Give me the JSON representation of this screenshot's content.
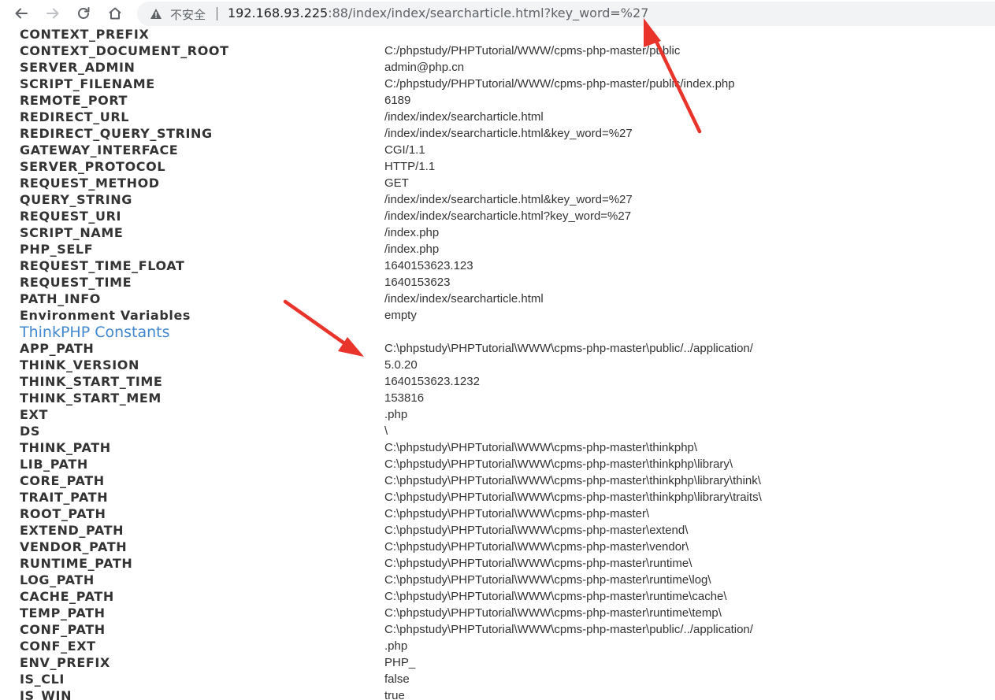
{
  "browser": {
    "insecure_label": "不安全",
    "url_host": "192.168.93.225",
    "url_rest": ":88/index/index/searcharticle.html?key_word=%27"
  },
  "rows_top": [
    {
      "key": "CONTEXT_PREFIX",
      "value": ""
    },
    {
      "key": "CONTEXT_DOCUMENT_ROOT",
      "value": "C:/phpstudy/PHPTutorial/WWW/cpms-php-master/public"
    },
    {
      "key": "SERVER_ADMIN",
      "value": "admin@php.cn"
    },
    {
      "key": "SCRIPT_FILENAME",
      "value": "C:/phpstudy/PHPTutorial/WWW/cpms-php-master/public/index.php"
    },
    {
      "key": "REMOTE_PORT",
      "value": "6189"
    },
    {
      "key": "REDIRECT_URL",
      "value": "/index/index/searcharticle.html"
    },
    {
      "key": "REDIRECT_QUERY_STRING",
      "value": "/index/index/searcharticle.html&key_word=%27"
    },
    {
      "key": "GATEWAY_INTERFACE",
      "value": "CGI/1.1"
    },
    {
      "key": "SERVER_PROTOCOL",
      "value": "HTTP/1.1"
    },
    {
      "key": "REQUEST_METHOD",
      "value": "GET"
    },
    {
      "key": "QUERY_STRING",
      "value": "/index/index/searcharticle.html&key_word=%27"
    },
    {
      "key": "REQUEST_URI",
      "value": "/index/index/searcharticle.html?key_word=%27"
    },
    {
      "key": "SCRIPT_NAME",
      "value": "/index.php"
    },
    {
      "key": "PHP_SELF",
      "value": "/index.php"
    },
    {
      "key": "REQUEST_TIME_FLOAT",
      "value": "1640153623.123"
    },
    {
      "key": "REQUEST_TIME",
      "value": "1640153623"
    },
    {
      "key": "PATH_INFO",
      "value": "/index/index/searcharticle.html"
    },
    {
      "key": "Environment Variables",
      "value": "empty"
    }
  ],
  "section_title": "ThinkPHP Constants",
  "rows_constants": [
    {
      "key": "APP_PATH",
      "value": "C:\\phpstudy\\PHPTutorial\\WWW\\cpms-php-master\\public/../application/"
    },
    {
      "key": "THINK_VERSION",
      "value": "5.0.20"
    },
    {
      "key": "THINK_START_TIME",
      "value": "1640153623.1232"
    },
    {
      "key": "THINK_START_MEM",
      "value": "153816"
    },
    {
      "key": "EXT",
      "value": ".php"
    },
    {
      "key": "DS",
      "value": "\\"
    },
    {
      "key": "THINK_PATH",
      "value": "C:\\phpstudy\\PHPTutorial\\WWW\\cpms-php-master\\thinkphp\\"
    },
    {
      "key": "LIB_PATH",
      "value": "C:\\phpstudy\\PHPTutorial\\WWW\\cpms-php-master\\thinkphp\\library\\"
    },
    {
      "key": "CORE_PATH",
      "value": "C:\\phpstudy\\PHPTutorial\\WWW\\cpms-php-master\\thinkphp\\library\\think\\"
    },
    {
      "key": "TRAIT_PATH",
      "value": "C:\\phpstudy\\PHPTutorial\\WWW\\cpms-php-master\\thinkphp\\library\\traits\\"
    },
    {
      "key": "ROOT_PATH",
      "value": "C:\\phpstudy\\PHPTutorial\\WWW\\cpms-php-master\\"
    },
    {
      "key": "EXTEND_PATH",
      "value": "C:\\phpstudy\\PHPTutorial\\WWW\\cpms-php-master\\extend\\"
    },
    {
      "key": "VENDOR_PATH",
      "value": "C:\\phpstudy\\PHPTutorial\\WWW\\cpms-php-master\\vendor\\"
    },
    {
      "key": "RUNTIME_PATH",
      "value": "C:\\phpstudy\\PHPTutorial\\WWW\\cpms-php-master\\runtime\\"
    },
    {
      "key": "LOG_PATH",
      "value": "C:\\phpstudy\\PHPTutorial\\WWW\\cpms-php-master\\runtime\\log\\"
    },
    {
      "key": "CACHE_PATH",
      "value": "C:\\phpstudy\\PHPTutorial\\WWW\\cpms-php-master\\runtime\\cache\\"
    },
    {
      "key": "TEMP_PATH",
      "value": "C:\\phpstudy\\PHPTutorial\\WWW\\cpms-php-master\\runtime\\temp\\"
    },
    {
      "key": "CONF_PATH",
      "value": "C:\\phpstudy\\PHPTutorial\\WWW\\cpms-php-master\\public/../application/"
    },
    {
      "key": "CONF_EXT",
      "value": ".php"
    },
    {
      "key": "ENV_PREFIX",
      "value": "PHP_"
    },
    {
      "key": "IS_CLI",
      "value": "false"
    },
    {
      "key": "IS_WIN",
      "value": "true"
    }
  ],
  "colors": {
    "section_title": "#4288ce",
    "annotation_arrow": "#e8342a"
  },
  "icons": [
    "back-icon",
    "forward-icon",
    "reload-icon",
    "home-icon",
    "warning-icon"
  ]
}
